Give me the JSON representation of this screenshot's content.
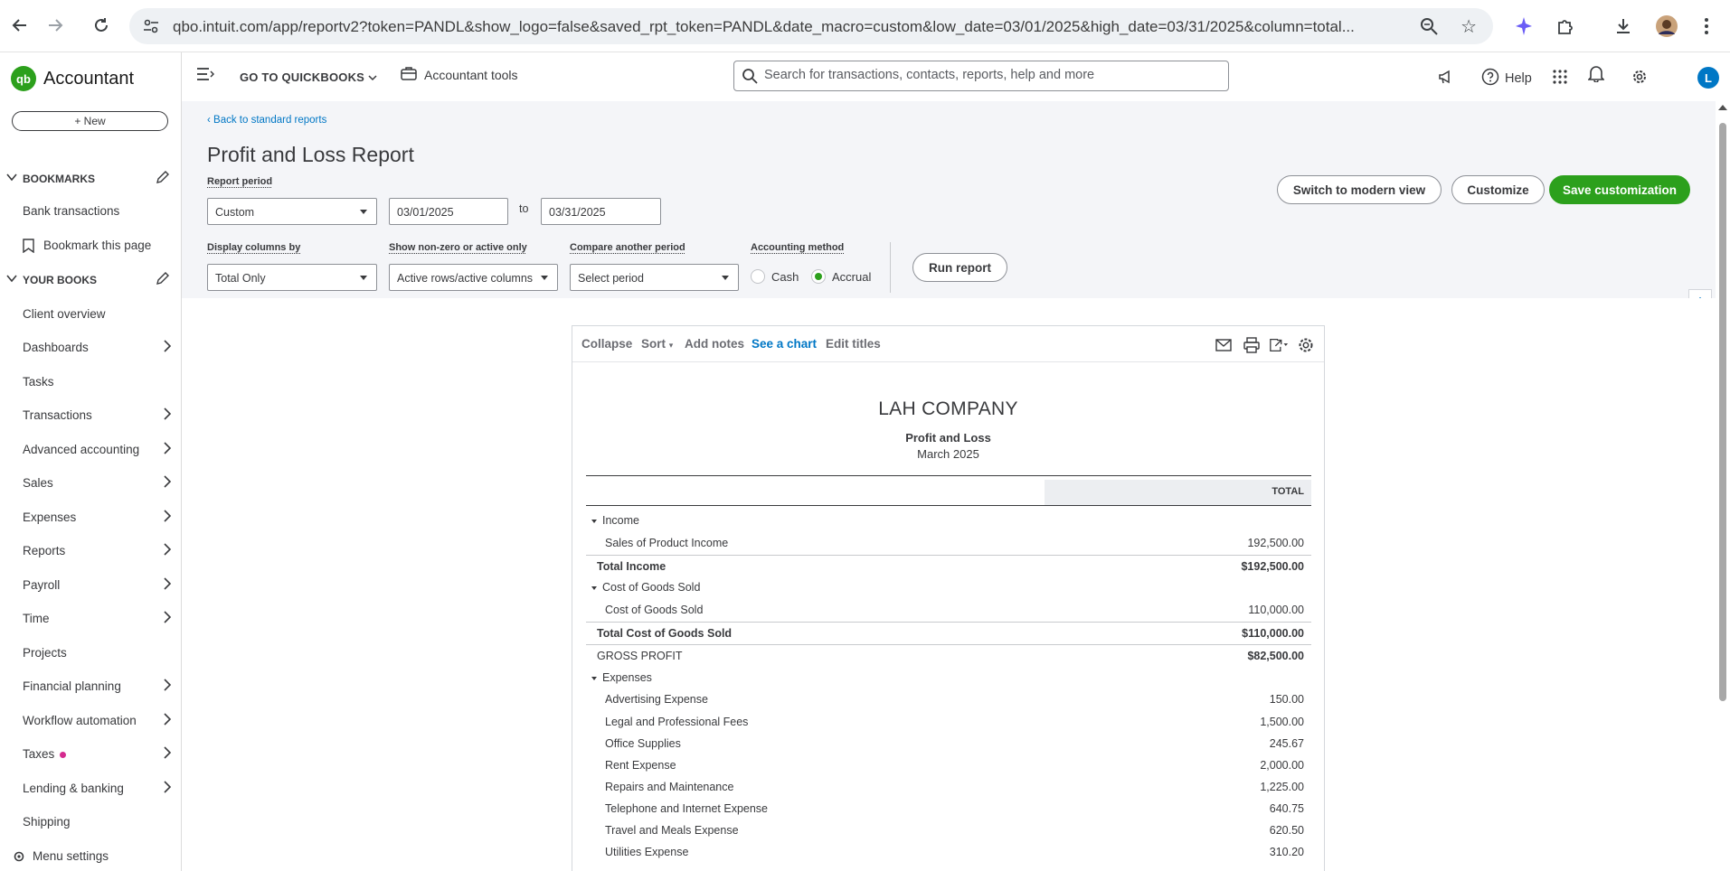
{
  "browser": {
    "url": "qbo.intuit.com/app/reportv2?token=PANDL&show_logo=false&saved_rpt_token=PANDL&date_macro=custom&low_date=03/01/2025&high_date=03/31/2025&column=total..."
  },
  "sidebar": {
    "brand": "Accountant",
    "logo_text": "qb",
    "new_label": "+ New",
    "bookmarks_title": "BOOKMARKS",
    "bookmarks": [
      {
        "label": "Bank transactions"
      },
      {
        "label": "Bookmark this page"
      }
    ],
    "your_books_title": "YOUR BOOKS",
    "items": [
      {
        "label": "Client overview"
      },
      {
        "label": "Dashboards"
      },
      {
        "label": "Tasks"
      },
      {
        "label": "Transactions"
      },
      {
        "label": "Advanced accounting"
      },
      {
        "label": "Sales"
      },
      {
        "label": "Expenses"
      },
      {
        "label": "Reports"
      },
      {
        "label": "Payroll"
      },
      {
        "label": "Time"
      },
      {
        "label": "Projects"
      },
      {
        "label": "Financial planning"
      },
      {
        "label": "Workflow automation"
      },
      {
        "label": "Taxes"
      },
      {
        "label": "Lending & banking"
      },
      {
        "label": "Shipping"
      }
    ],
    "menu_settings": "Menu settings"
  },
  "topbar": {
    "goto_label": "GO TO QUICKBOOKS",
    "accountant_tools": "Accountant tools",
    "search_placeholder": "Search for transactions, contacts, reports, help and more",
    "help_label": "Help",
    "avatar_letter": "L"
  },
  "header": {
    "back_link": "Back to standard reports",
    "title": "Profit and Loss Report",
    "report_period_label": "Report period",
    "report_period_value": "Custom",
    "date_from": "03/01/2025",
    "to_label": "to",
    "date_to": "03/31/2025",
    "display_columns_label": "Display columns by",
    "display_columns_value": "Total Only",
    "show_nonzero_label": "Show non-zero or active only",
    "show_nonzero_value": "Active rows/active columns",
    "compare_label": "Compare another period",
    "compare_value": "Select period",
    "accounting_method_label": "Accounting method",
    "cash_label": "Cash",
    "accrual_label": "Accrual",
    "accounting_method_selected": "Accrual",
    "run_report": "Run report",
    "switch_modern": "Switch to modern view",
    "customize": "Customize",
    "save_customization": "Save customization"
  },
  "report_toolbar": {
    "collapse": "Collapse",
    "sort": "Sort",
    "add_notes": "Add notes",
    "see_chart": "See a chart",
    "edit_titles": "Edit titles"
  },
  "report": {
    "company": "LAH COMPANY",
    "name": "Profit and Loss",
    "period": "March 2025",
    "column_header": "TOTAL",
    "rows": [
      {
        "name": "Income",
        "amount": "",
        "type": "section"
      },
      {
        "name": "Sales of Product Income",
        "amount": "192,500.00",
        "type": "item"
      },
      {
        "name": "Total Income",
        "amount": "$192,500.00",
        "type": "total"
      },
      {
        "name": "Cost of Goods Sold",
        "amount": "",
        "type": "section"
      },
      {
        "name": "Cost of Goods Sold",
        "amount": "110,000.00",
        "type": "item"
      },
      {
        "name": "Total Cost of Goods Sold",
        "amount": "$110,000.00",
        "type": "total"
      },
      {
        "name": "GROSS PROFIT",
        "amount": "$82,500.00",
        "type": "gross"
      },
      {
        "name": "Expenses",
        "amount": "",
        "type": "section"
      },
      {
        "name": "Advertising Expense",
        "amount": "150.00",
        "type": "item"
      },
      {
        "name": "Legal and Professional Fees",
        "amount": "1,500.00",
        "type": "item"
      },
      {
        "name": "Office Supplies",
        "amount": "245.67",
        "type": "item"
      },
      {
        "name": "Rent Expense",
        "amount": "2,000.00",
        "type": "item"
      },
      {
        "name": "Repairs and Maintenance",
        "amount": "1,225.00",
        "type": "item"
      },
      {
        "name": "Telephone and Internet Expense",
        "amount": "640.75",
        "type": "item"
      },
      {
        "name": "Travel and Meals Expense",
        "amount": "620.50",
        "type": "item"
      },
      {
        "name": "Utilities Expense",
        "amount": "310.20",
        "type": "item"
      }
    ]
  },
  "colors": {
    "brand_green": "#2ca01c",
    "link_blue": "#0077c5",
    "text": "#393a3d"
  }
}
